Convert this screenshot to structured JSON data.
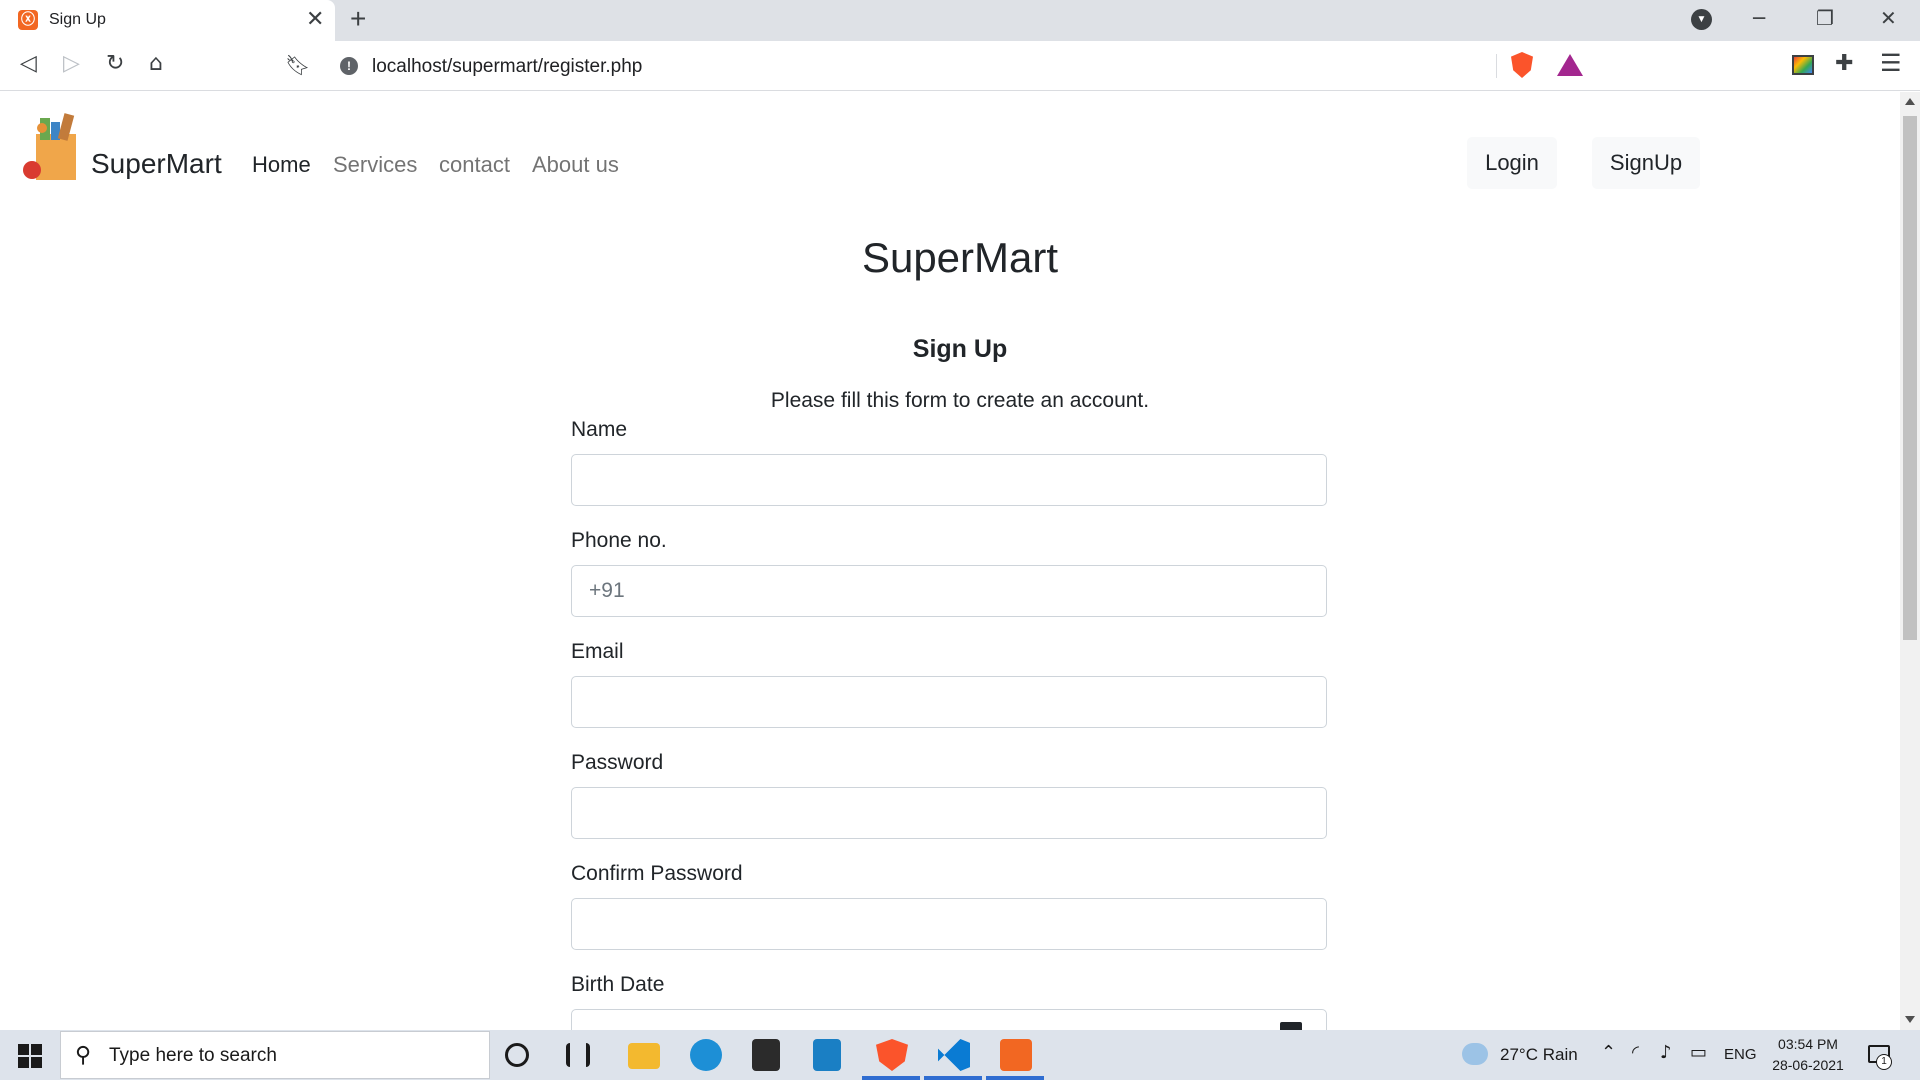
{
  "browser": {
    "tab_title": "Sign Up",
    "tab_close_glyph": "✕",
    "new_tab_glyph": "+",
    "url": "localhost/supermart/register.php",
    "icons": {
      "back": "back-icon",
      "forward": "forward-icon",
      "reload": "reload-icon",
      "home": "home-icon",
      "bookmark": "bookmark-icon",
      "info": "info-icon",
      "brave_shield": "brave-shield-icon",
      "brave_rewards": "brave-rewards-icon",
      "extensions": "puzzle-icon",
      "menu": "menu-icon"
    },
    "colors": {
      "tabbar": "#dee1e6",
      "brave_orange": "#fb542b",
      "rewards_purple": "#a3278f"
    }
  },
  "navbar": {
    "brand": "SuperMart",
    "links": [
      "Home",
      "Services",
      "contact",
      "About us"
    ],
    "login_label": "Login",
    "signup_label": "SignUp"
  },
  "main": {
    "site_title": "SuperMart",
    "form_title": "Sign Up",
    "form_subtitle": "Please fill this form to create an account.",
    "fields": [
      {
        "label": "Name",
        "value": "",
        "placeholder": ""
      },
      {
        "label": "Phone no.",
        "value": "",
        "placeholder": "+91"
      },
      {
        "label": "Email",
        "value": "",
        "placeholder": ""
      },
      {
        "label": "Password",
        "value": "",
        "placeholder": ""
      },
      {
        "label": "Confirm Password",
        "value": "",
        "placeholder": ""
      },
      {
        "label": "Birth Date",
        "value": "",
        "placeholder": ""
      }
    ]
  },
  "taskbar": {
    "search_placeholder": "Type here to search",
    "weather": "27°C  Rain",
    "language": "ENG",
    "time": "03:54 PM",
    "date": "28-06-2021",
    "notification_count": "1",
    "apps": [
      "cortana-icon",
      "task-view-icon",
      "file-explorer-icon",
      "edge-icon",
      "store-icon",
      "app-icon",
      "brave-icon",
      "vscode-icon",
      "xampp-icon"
    ]
  }
}
